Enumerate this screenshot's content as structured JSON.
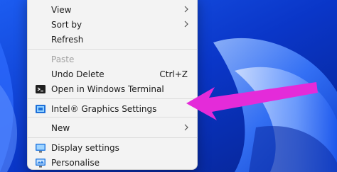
{
  "menu": {
    "items": [
      {
        "label": "View",
        "submenu": true
      },
      {
        "label": "Sort by",
        "submenu": true
      },
      {
        "label": "Refresh"
      },
      {
        "label": "Paste",
        "disabled": true
      },
      {
        "label": "Undo Delete",
        "shortcut": "Ctrl+Z"
      },
      {
        "label": "Open in Windows Terminal",
        "icon": "terminal-icon"
      },
      {
        "label": "Intel® Graphics Settings",
        "icon": "intel-graphics-icon"
      },
      {
        "label": "New",
        "submenu": true
      },
      {
        "label": "Display settings",
        "icon": "display-settings-icon"
      },
      {
        "label": "Personalise",
        "icon": "personalise-icon"
      }
    ]
  },
  "annotation": {
    "color": "#e42bd9",
    "points_to": "Intel® Graphics Settings"
  },
  "colors": {
    "wallpaper": "#0b3dd6",
    "menu_bg": "#f3f3f3"
  }
}
